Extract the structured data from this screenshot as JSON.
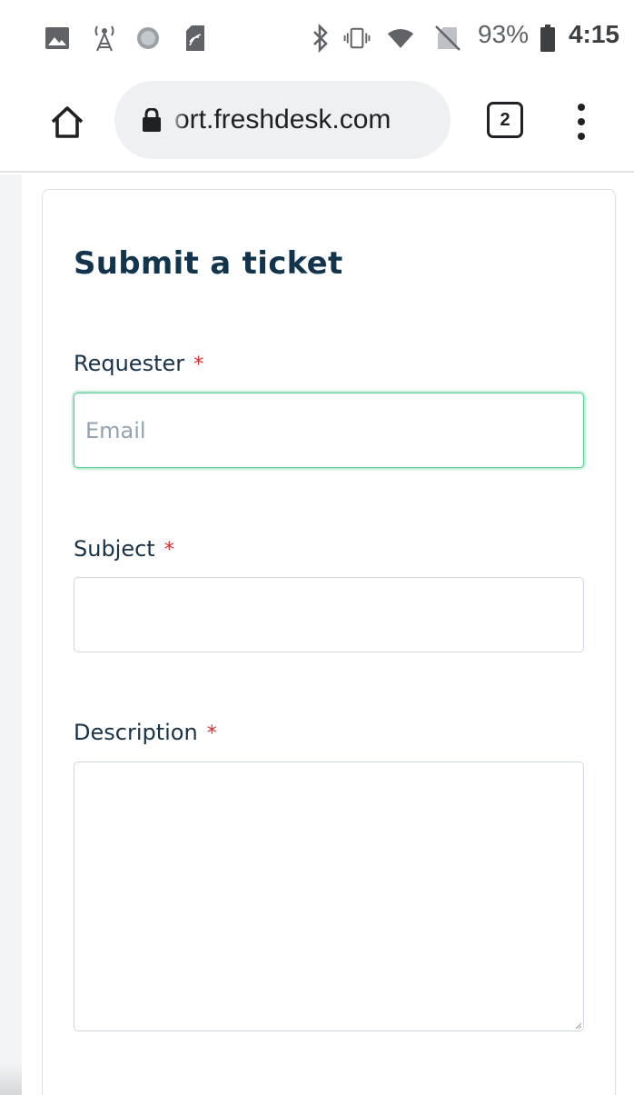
{
  "status_bar": {
    "icons": [
      "image-icon",
      "cell-tower-icon",
      "sync-circle-icon",
      "sim-card-icon",
      "bluetooth-icon",
      "vibrate-icon",
      "wifi-icon",
      "no-sim-icon",
      "battery-icon"
    ],
    "battery": "93%",
    "time": "4:15"
  },
  "browser": {
    "url": "ort.freshdesk.com",
    "tab_count": "2",
    "icons": [
      "home-icon",
      "lock-icon",
      "more-vert-icon"
    ]
  },
  "form": {
    "title": "Submit a ticket",
    "requester": {
      "label": "Requester",
      "required_mark": "*",
      "placeholder": "Email",
      "value": ""
    },
    "subject": {
      "label": "Subject",
      "required_mark": "*",
      "value": ""
    },
    "description": {
      "label": "Description",
      "required_mark": "*",
      "value": ""
    }
  },
  "colors": {
    "title": "#12344d",
    "required": "#d72d30",
    "focus_border": "#5bcf95",
    "field_border": "#cfd7df"
  }
}
